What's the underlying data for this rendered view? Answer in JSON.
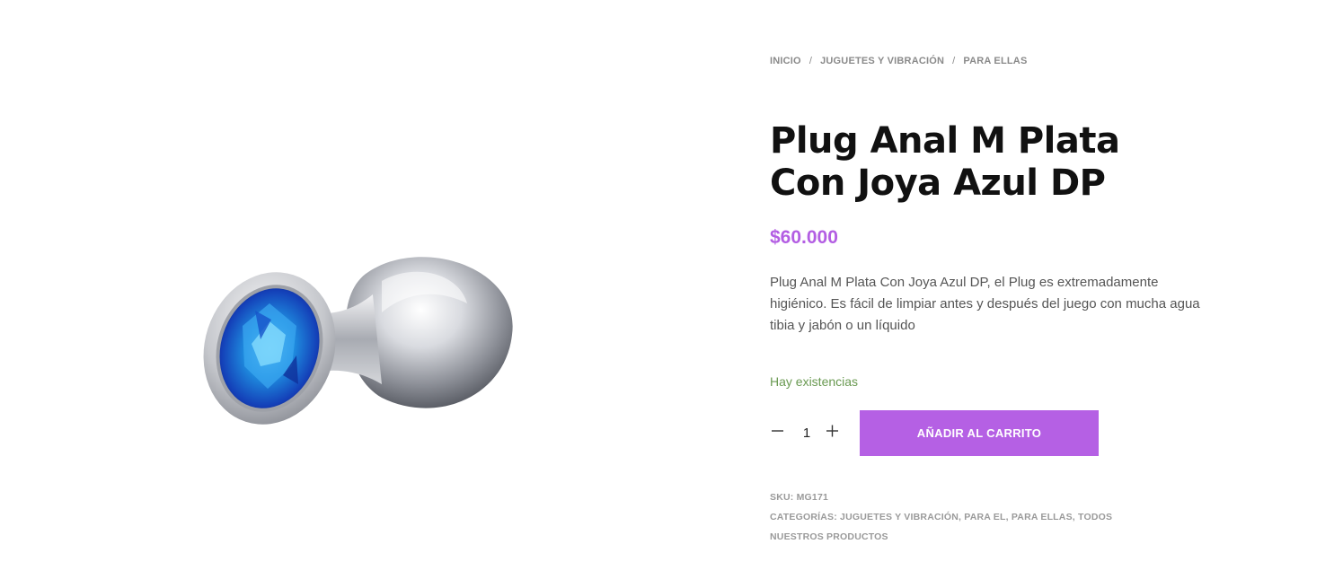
{
  "breadcrumb": {
    "items": [
      "INICIO",
      "JUGUETES Y VIBRACIÓN",
      "PARA ELLAS"
    ],
    "separator": "/"
  },
  "product": {
    "title": "Plug Anal M Plata Con Joya Azul DP",
    "price": "$60.000",
    "description": "Plug Anal M Plata Con Joya Azul DP, el Plug es extremadamente higiénico. Es fácil de limpiar antes y después del juego con mucha agua tibia y jabón o un líquido",
    "stock": "Hay existencias",
    "quantity": "1",
    "add_to_cart_label": "AÑADIR AL CARRITO",
    "sku_label": "SKU:",
    "sku": "MG171",
    "categories_label": "CATEGORÍAS:",
    "categories": [
      "JUGUETES Y VIBRACIÓN",
      "PARA EL",
      "PARA ELLAS",
      "TODOS NUESTROS PRODUCTOS"
    ]
  },
  "colors": {
    "accent": "#b560e4",
    "price": "#b35ee3",
    "stock": "#6a9a52"
  },
  "icons": {
    "minus": "minus-icon",
    "plus": "plus-icon"
  }
}
